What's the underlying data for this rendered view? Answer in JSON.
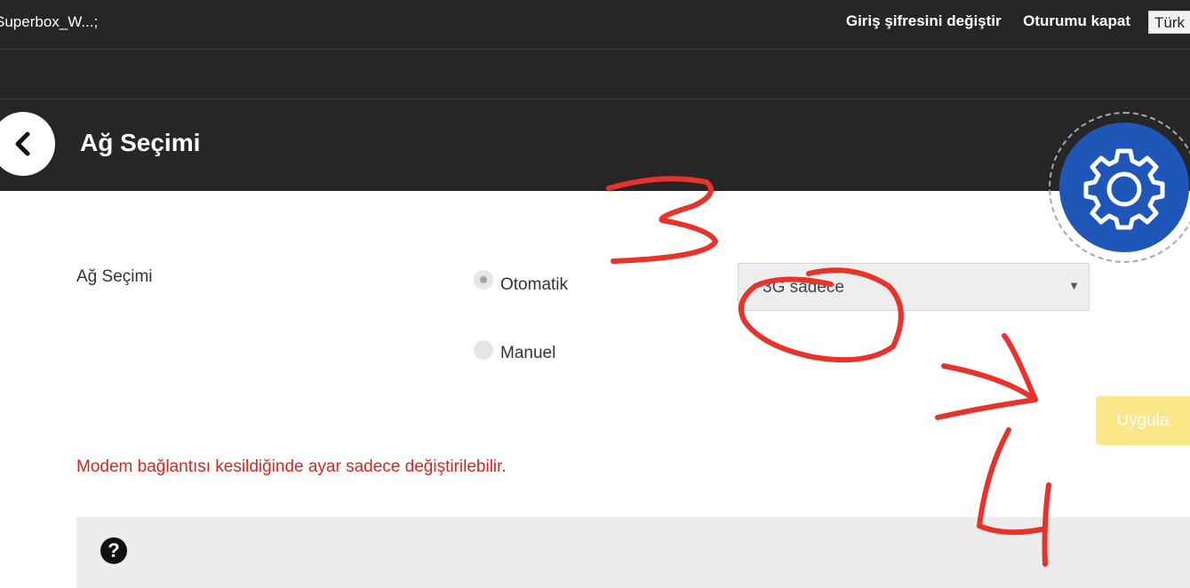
{
  "header": {
    "device_name": "Superbox_W...;",
    "change_password": "Giriş şifresini değiştir",
    "logout": "Oturumu kapat",
    "language": "Türk"
  },
  "page": {
    "title": "Ağ Seçimi"
  },
  "form": {
    "label": "Ağ Seçimi",
    "options": [
      {
        "label": "Otomatik",
        "selected": true
      },
      {
        "label": "Manuel",
        "selected": false
      }
    ],
    "network_mode": "3G sadece",
    "apply_label": "Uygula",
    "warning": "Modem bağlantısı kesildiğinde ayar sadece değiştirilebilir."
  },
  "help": {
    "icon_glyph": "?"
  },
  "annotations": {
    "step_3": "3",
    "step_4": "4",
    "ink_color": "#e8322a"
  },
  "colors": {
    "header_bg": "#262626",
    "gear_blue": "#1f57b8",
    "apply_yellow": "#fbe68a",
    "warning_red": "#d9261c"
  }
}
